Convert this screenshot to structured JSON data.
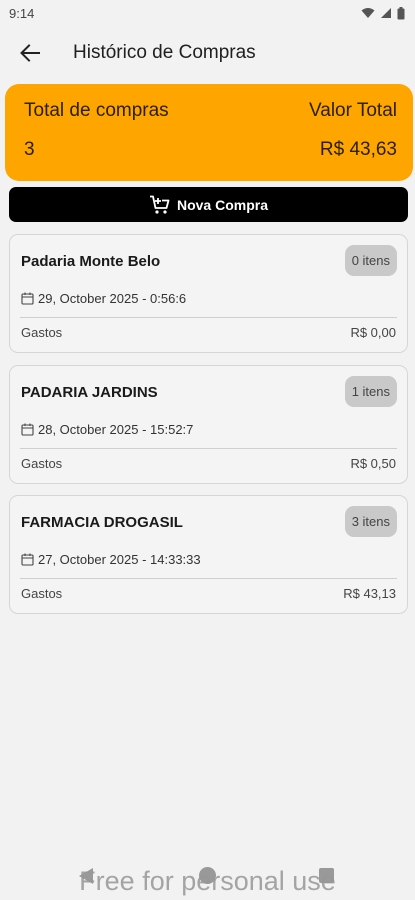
{
  "status_bar": {
    "time": "9:14",
    "icons": [
      "wifi-icon",
      "signal-icon",
      "battery-icon"
    ]
  },
  "app_bar": {
    "back_icon": "arrow-left-icon",
    "title": "Histórico de Compras"
  },
  "summary": {
    "total_label": "Total de compras",
    "value_label": "Valor Total",
    "total_count": "3",
    "total_value": "R$ 43,63",
    "color": "#ffa500"
  },
  "new_purchase": {
    "icon": "cart-add-icon",
    "label": "Nova Compra"
  },
  "purchases": [
    {
      "store": "Padaria Monte Belo",
      "items": "0 itens",
      "date": "29, October 2025 - 0:56:6",
      "label": "Gastos",
      "amount": "R$ 0,00"
    },
    {
      "store": "PADARIA JARDINS",
      "items": "1 itens",
      "date": "28, October 2025 - 15:52:7",
      "label": "Gastos",
      "amount": "R$ 0,50"
    },
    {
      "store": "FARMACIA DROGASIL",
      "items": "3 itens",
      "date": "27, October 2025 - 14:33:33",
      "label": "Gastos",
      "amount": "R$ 43,13"
    }
  ],
  "nav_bar": {
    "icons": [
      "nav-back-icon",
      "nav-home-icon",
      "nav-recents-icon"
    ]
  },
  "watermark": "Free for personal use"
}
